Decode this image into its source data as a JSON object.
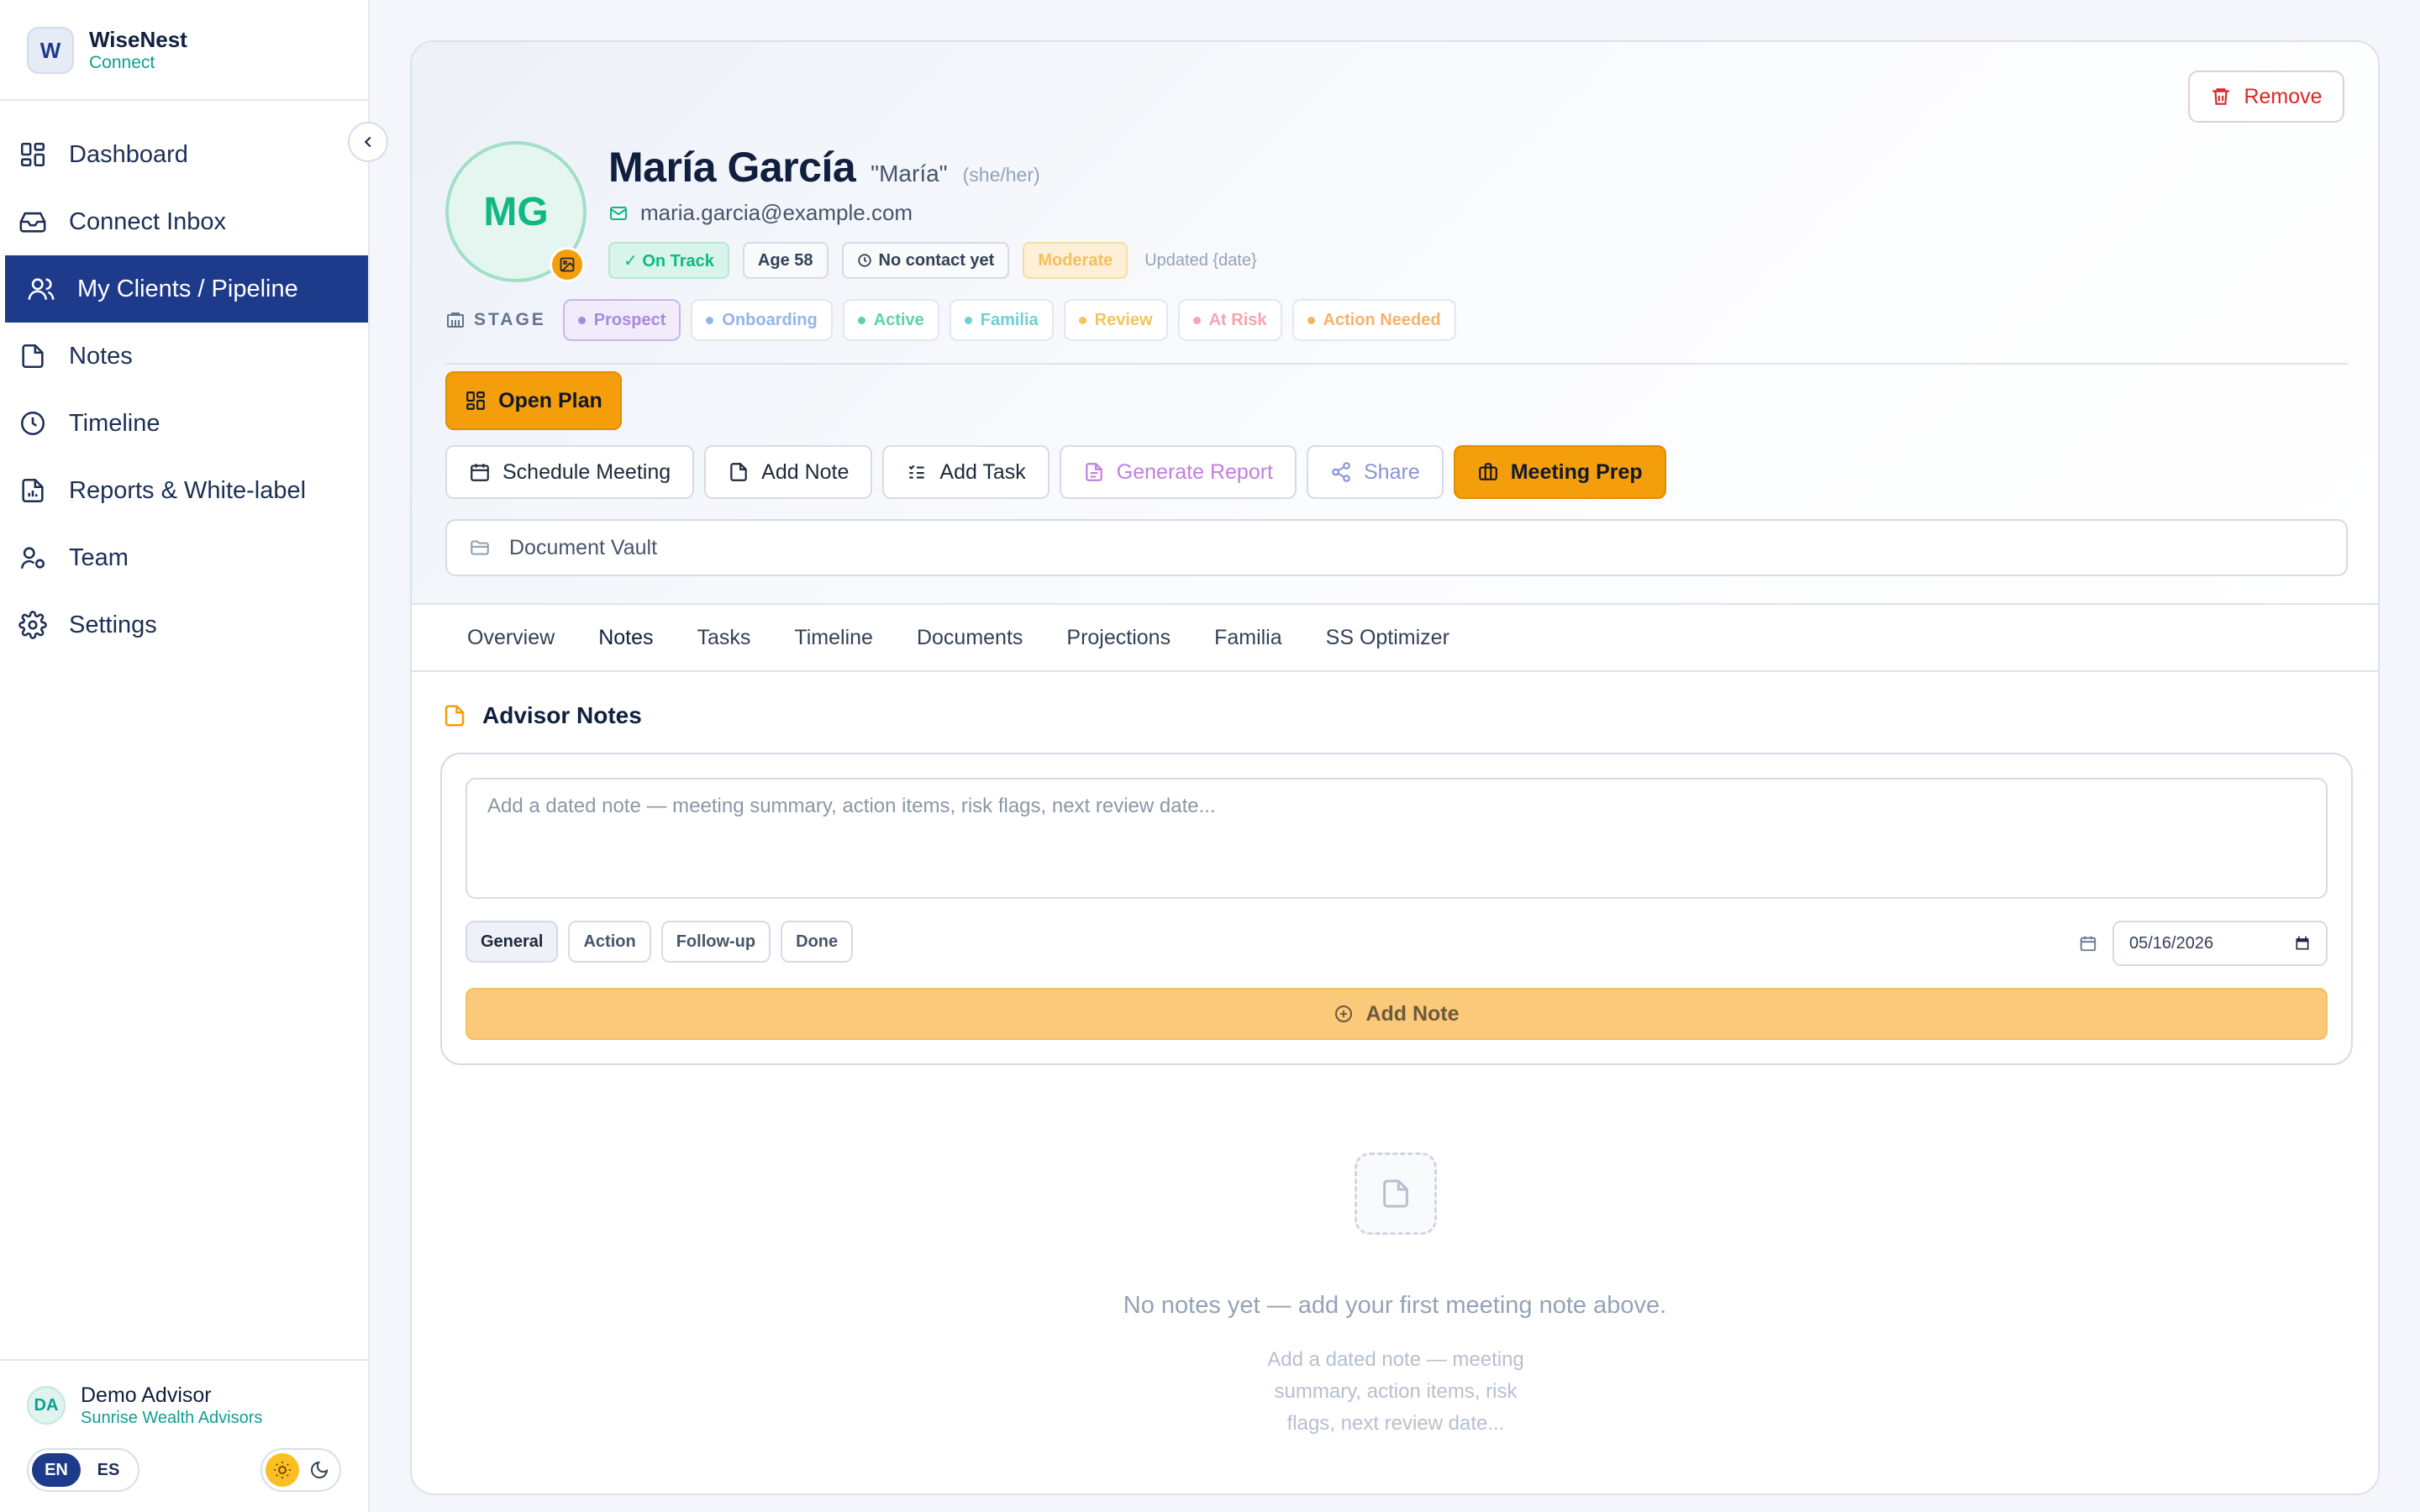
{
  "brand": {
    "name": "WiseNest",
    "sub": "Connect",
    "logo_letter": "W"
  },
  "nav": {
    "items": [
      {
        "label": "Dashboard",
        "icon": "grid-icon"
      },
      {
        "label": "Connect Inbox",
        "icon": "inbox-icon"
      },
      {
        "label": "My Clients / Pipeline",
        "icon": "users-icon",
        "active": true
      },
      {
        "label": "Notes",
        "icon": "file-icon"
      },
      {
        "label": "Timeline",
        "icon": "clock-icon"
      },
      {
        "label": "Reports & White-label",
        "icon": "report-icon"
      },
      {
        "label": "Team",
        "icon": "team-icon"
      },
      {
        "label": "Settings",
        "icon": "gear-icon"
      }
    ]
  },
  "user": {
    "initials": "DA",
    "name": "Demo Advisor",
    "org": "Sunrise Wealth Advisors"
  },
  "lang": {
    "en": "EN",
    "es": "ES"
  },
  "client": {
    "initials": "MG",
    "name": "María García",
    "nickname": "\"María\"",
    "pronouns": "(she/her)",
    "email": "maria.garcia@example.com",
    "badges": {
      "on_track": "✓ On Track",
      "age": "Age 58",
      "contact": "No contact yet",
      "risk": "Moderate"
    },
    "updated": "Updated {date}"
  },
  "remove_label": "Remove",
  "stage": {
    "label": "STAGE",
    "items": [
      {
        "label": "Prospect",
        "color": "#a78bdb",
        "selected": true
      },
      {
        "label": "Onboarding",
        "color": "#93b4e8"
      },
      {
        "label": "Active",
        "color": "#5fd1ad"
      },
      {
        "label": "Familia",
        "color": "#6fd0d2"
      },
      {
        "label": "Review",
        "color": "#f5c45a"
      },
      {
        "label": "At Risk",
        "color": "#f3a5b0"
      },
      {
        "label": "Action Needed",
        "color": "#f5b36a"
      }
    ]
  },
  "open_plan_label": "Open Plan",
  "actions": {
    "schedule": "Schedule Meeting",
    "add_note": "Add Note",
    "add_task": "Add Task",
    "report": "Generate Report",
    "share": "Share",
    "prep": "Meeting Prep"
  },
  "vault_label": "Document Vault",
  "tabs": [
    "Overview",
    "Notes",
    "Tasks",
    "Timeline",
    "Documents",
    "Projections",
    "Familia",
    "SS Optimizer"
  ],
  "notes": {
    "title": "Advisor Notes",
    "placeholder": "Add a dated note — meeting summary, action items, risk flags, next review date...",
    "chips": [
      "General",
      "Action",
      "Follow-up",
      "Done"
    ],
    "date": "05/16/2026",
    "add_label": "Add Note",
    "empty_title": "No notes yet — add your first meeting note above.",
    "empty_sub": "Add a dated note — meeting summary, action items, risk flags, next review date..."
  },
  "colors": {
    "accent": "#f59e0b",
    "primary": "#1e3a8a",
    "teal": "#0f9f8f"
  }
}
